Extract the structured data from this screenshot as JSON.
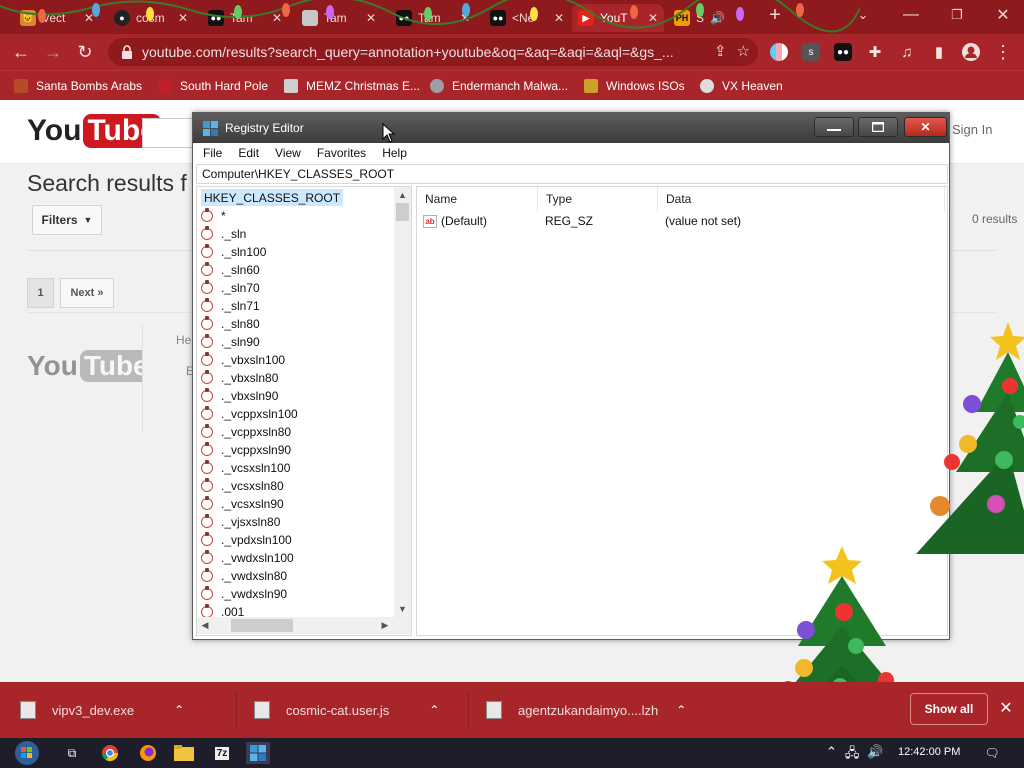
{
  "tabs": [
    {
      "label": "Vect",
      "active": false
    },
    {
      "label": "cosm",
      "active": false
    },
    {
      "label": "Tam",
      "active": false
    },
    {
      "label": "Tam",
      "active": false
    },
    {
      "label": "Tam",
      "active": false
    },
    {
      "label": "<Ne",
      "active": false
    },
    {
      "label": "YouT",
      "active": true
    },
    {
      "label": "S",
      "active": false
    }
  ],
  "window_controls": {
    "minimize": "—",
    "restore": "❐",
    "close": "✕"
  },
  "address": {
    "url": "youtube.com/results?search_query=annotation+youtube&oq=&aq=&aqi=&aql=&gs_..."
  },
  "extension_badge": "1",
  "bookmarks": [
    {
      "label": "Santa Bombs Arabs",
      "color": "#b74a2a"
    },
    {
      "label": "South Hard Pole",
      "color": "#c41e2a"
    },
    {
      "label": "MEMZ Christmas E...",
      "color": "#d0d0d0"
    },
    {
      "label": "Endermanch Malwa...",
      "color": "#9aa0a6"
    },
    {
      "label": "Windows ISOs",
      "color": "#c9a227"
    },
    {
      "label": "VX Heaven",
      "color": "#dddddd"
    }
  ],
  "youtube": {
    "logo_you": "You",
    "logo_tube": "Tube",
    "signin": "Sign In",
    "results_title": "Search results f",
    "filters": "Filters",
    "results_count": "0 results",
    "page_1": "1",
    "next": "Next »",
    "he_1": "He",
    "he_2": "E"
  },
  "regedit": {
    "title": "Registry Editor",
    "menu": [
      "File",
      "Edit",
      "View",
      "Favorites",
      "Help"
    ],
    "address": "Computer\\HKEY_CLASSES_ROOT",
    "root": "HKEY_CLASSES_ROOT",
    "tree": [
      "*",
      "._sln",
      "._sln100",
      "._sln60",
      "._sln70",
      "._sln71",
      "._sln80",
      "._sln90",
      "._vbxsln100",
      "._vbxsln80",
      "._vbxsln90",
      "._vcppxsln100",
      "._vcppxsln80",
      "._vcppxsln90",
      "._vcsxsln100",
      "._vcsxsln80",
      "._vcsxsln90",
      "._vjsxsln80",
      "._vpdxsln100",
      "._vwdxsln100",
      "._vwdxsln80",
      "._vwdxsln90",
      ".001"
    ],
    "columns": {
      "name": "Name",
      "type": "Type",
      "data": "Data"
    },
    "values": [
      {
        "name": "(Default)",
        "type": "REG_SZ",
        "data": "(value not set)",
        "icon": "ab"
      }
    ]
  },
  "downloads": [
    {
      "name": "vipv3_dev.exe"
    },
    {
      "name": "cosmic-cat.user.js"
    },
    {
      "name": "agentzukandaimyo....lzh"
    }
  ],
  "show_all": "Show all",
  "taskbar": {
    "time": "12:42:00 PM"
  },
  "theme": {
    "chrome_dark": "#8e1a1d",
    "chrome": "#a8262a",
    "youtube_red": "#cc181e",
    "selection": "#cce8ff"
  }
}
